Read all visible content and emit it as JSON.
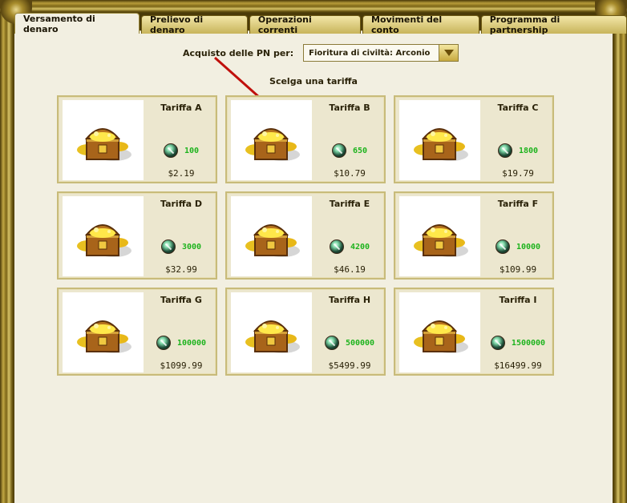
{
  "tabs": [
    {
      "label": "Versamento di denaro",
      "active": true
    },
    {
      "label": "Prelievo di denaro",
      "active": false
    },
    {
      "label": "Operazioni correnti",
      "active": false
    },
    {
      "label": "Movimenti del conto",
      "active": false
    },
    {
      "label": "Programma di partnership",
      "active": false
    }
  ],
  "purchase": {
    "label": "Acquisto delle PN per:",
    "selected": "Fioritura di civiltà: Arconio",
    "dropdown_icon": "chevron-down-icon"
  },
  "subtitle": "Scelga una tariffa",
  "colors": {
    "amount": "#1db31d",
    "panel": "#f2efe1",
    "accent": "#c8aa40"
  },
  "tariffs": [
    {
      "name": "Tariffa A",
      "amount": "100",
      "price": "$2.19"
    },
    {
      "name": "Tariffa B",
      "amount": "650",
      "price": "$10.79"
    },
    {
      "name": "Tariffa C",
      "amount": "1800",
      "price": "$19.79"
    },
    {
      "name": "Tariffa D",
      "amount": "3000",
      "price": "$32.99"
    },
    {
      "name": "Tariffa E",
      "amount": "4200",
      "price": "$46.19"
    },
    {
      "name": "Tariffa F",
      "amount": "10000",
      "price": "$109.99"
    },
    {
      "name": "Tariffa G",
      "amount": "100000",
      "price": "$1099.99"
    },
    {
      "name": "Tariffa H",
      "amount": "500000",
      "price": "$5499.99"
    },
    {
      "name": "Tariffa I",
      "amount": "1500000",
      "price": "$16499.99"
    }
  ]
}
